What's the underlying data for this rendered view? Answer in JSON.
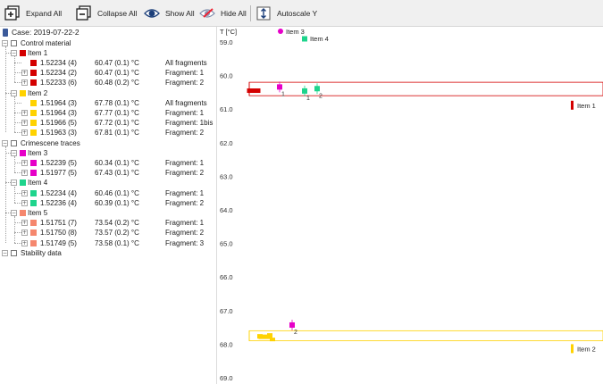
{
  "toolbar": {
    "buttons": [
      {
        "label": "Expand All",
        "icon": "expand-all-icon"
      },
      {
        "label": "Collapse All",
        "icon": "collapse-all-icon"
      },
      {
        "label": "Show All",
        "icon": "eye-icon"
      },
      {
        "label": "Hide All",
        "icon": "eye-crossed-icon"
      },
      {
        "label": "Autoscale Y",
        "icon": "autoscale-y-icon"
      }
    ]
  },
  "tree": {
    "case_label": "Case: 2019-07-22-2",
    "groups": [
      {
        "label": "Control material",
        "items": [
          {
            "label": "Item 1",
            "color": "#d40000",
            "fragments": [
              {
                "id": "1.52234 (4)",
                "temp": "60.47 (0.1) °C",
                "frag": "All fragments"
              },
              {
                "id": "1.52234 (2)",
                "temp": "60.47 (0.1) °C",
                "frag": "Fragment: 1"
              },
              {
                "id": "1.52233 (6)",
                "temp": "60.48 (0.2) °C",
                "frag": "Fragment: 2"
              }
            ]
          },
          {
            "label": "Item 2",
            "color": "#ffd200",
            "fragments": [
              {
                "id": "1.51964 (3)",
                "temp": "67.78 (0.1) °C",
                "frag": "All fragments"
              },
              {
                "id": "1.51964 (3)",
                "temp": "67.77 (0.1) °C",
                "frag": "Fragment: 1"
              },
              {
                "id": "1.51966 (5)",
                "temp": "67.72 (0.1) °C",
                "frag": "Fragment: 1bis"
              },
              {
                "id": "1.51963 (3)",
                "temp": "67.81 (0.1) °C",
                "frag": "Fragment: 2"
              }
            ]
          }
        ]
      },
      {
        "label": "Crimescene traces",
        "items": [
          {
            "label": "Item 3",
            "color": "#e600c8",
            "fragments": [
              {
                "id": "1.52239 (5)",
                "temp": "60.34 (0.1) °C",
                "frag": "Fragment: 1"
              },
              {
                "id": "1.51977 (5)",
                "temp": "67.43 (0.1) °C",
                "frag": "Fragment: 2"
              }
            ]
          },
          {
            "label": "Item 4",
            "color": "#1ed48c",
            "fragments": [
              {
                "id": "1.52234 (4)",
                "temp": "60.46 (0.1) °C",
                "frag": "Fragment: 1"
              },
              {
                "id": "1.52236 (4)",
                "temp": "60.39 (0.1) °C",
                "frag": "Fragment: 2"
              }
            ]
          },
          {
            "label": "Item 5",
            "color": "#f5876e",
            "fragments": [
              {
                "id": "1.51751 (7)",
                "temp": "73.54 (0.2) °C",
                "frag": "Fragment: 1"
              },
              {
                "id": "1.51750 (8)",
                "temp": "73.57 (0.2) °C",
                "frag": "Fragment: 2"
              },
              {
                "id": "1.51749 (5)",
                "temp": "73.58 (0.1) °C",
                "frag": "Fragment: 3"
              }
            ]
          }
        ]
      },
      {
        "label": "Stability data",
        "items": []
      }
    ]
  },
  "chart_data": {
    "type": "scatter",
    "ylabel": "T [°C]",
    "ylim": [
      59.0,
      69.0
    ],
    "y_inverted": true,
    "y_ticks": [
      "59.0",
      "60.0",
      "61.0",
      "62.0",
      "63.0",
      "64.0",
      "65.0",
      "66.0",
      "67.0",
      "68.0",
      "69.0"
    ],
    "legend": [
      {
        "label": "Item 3",
        "color": "#e600c8",
        "marker": "circle"
      },
      {
        "label": "Item 4",
        "color": "#1ed48c",
        "marker": "square"
      },
      {
        "label": "Item 1",
        "color": "#d40000",
        "marker": "bar"
      },
      {
        "label": "Item 2",
        "color": "#ffd200",
        "marker": "bar"
      }
    ],
    "bands": [
      {
        "series": "Item 1",
        "color": "#d40000",
        "y_low": 60.2,
        "y_high": 60.6
      },
      {
        "series": "Item 2",
        "color": "#ffd200",
        "y_low": 67.6,
        "y_high": 67.9
      }
    ],
    "points": [
      {
        "series": "Item 1",
        "color": "#d40000",
        "marker": "wide",
        "y": 60.45,
        "label": ""
      },
      {
        "series": "Item 3",
        "color": "#e600c8",
        "marker": "square",
        "y": 60.34,
        "label": "1"
      },
      {
        "series": "Item 4",
        "color": "#1ed48c",
        "marker": "square",
        "y": 60.46,
        "label": "1"
      },
      {
        "series": "Item 4",
        "color": "#1ed48c",
        "marker": "square",
        "y": 60.39,
        "label": "2"
      },
      {
        "series": "Item 3",
        "color": "#e600c8",
        "marker": "square",
        "y": 67.43,
        "label": "2"
      },
      {
        "series": "Item 2",
        "color": "#ffd200",
        "marker": "wide",
        "y": 67.78,
        "label": ""
      }
    ]
  }
}
